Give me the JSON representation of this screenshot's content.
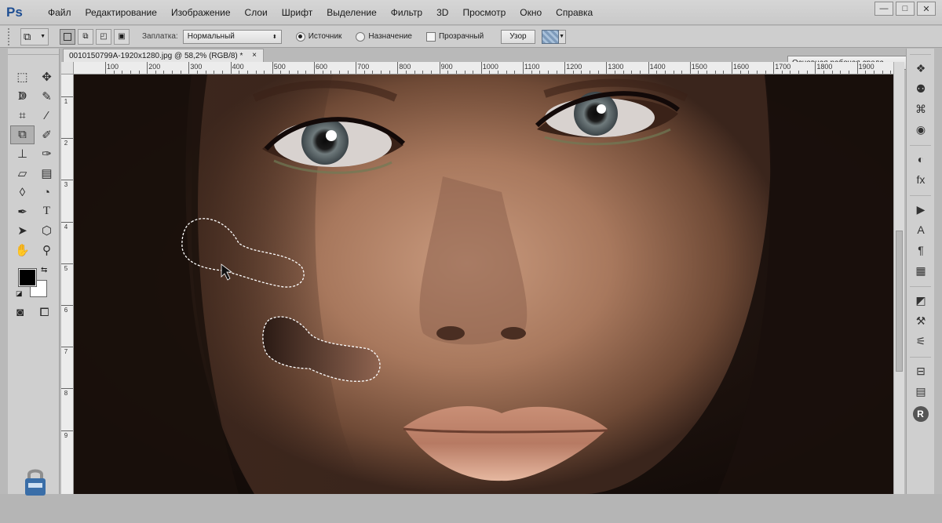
{
  "app": {
    "logo": "Ps"
  },
  "menu": [
    "Файл",
    "Редактирование",
    "Изображение",
    "Слои",
    "Шрифт",
    "Выделение",
    "Фильтр",
    "3D",
    "Просмотр",
    "Окно",
    "Справка"
  ],
  "window_controls": {
    "minimize": "—",
    "maximize": "□",
    "close": "✕"
  },
  "options": {
    "fill_label": "Заплатка:",
    "fill_mode": "Нормальный",
    "source_label": "Источник",
    "destination_label": "Назначение",
    "transparent_label": "Прозрачный",
    "pattern_label": "Узор",
    "workspace": "Основная рабочая среда",
    "selected_patch": "source"
  },
  "document": {
    "tab_title": "0010150799A-1920x1280.jpg @ 58,2% (RGB/8) *",
    "close": "×"
  },
  "ruler": {
    "h_labels": [
      "100",
      "200",
      "300",
      "400",
      "500",
      "600",
      "700",
      "800",
      "900",
      "1000",
      "1100",
      "1200",
      "1300",
      "1400",
      "1500",
      "1600",
      "1700",
      "1800",
      "1900"
    ],
    "v_labels": [
      "1",
      "2",
      "3",
      "4",
      "5",
      "6",
      "7",
      "8",
      "9"
    ]
  },
  "tools": [
    {
      "name": "marquee-tool-icon",
      "glyph": "⬚"
    },
    {
      "name": "move-tool-icon",
      "glyph": "✥"
    },
    {
      "name": "lasso-tool-icon",
      "glyph": "ↇ"
    },
    {
      "name": "quick-select-icon",
      "glyph": "✎"
    },
    {
      "name": "crop-tool-icon",
      "glyph": "⌗"
    },
    {
      "name": "eyedropper-icon",
      "glyph": "⁄"
    },
    {
      "name": "patch-tool-icon",
      "glyph": "⧉"
    },
    {
      "name": "brush-tool-icon",
      "glyph": "✐"
    },
    {
      "name": "stamp-tool-icon",
      "glyph": "⊥"
    },
    {
      "name": "history-brush-icon",
      "glyph": "✑"
    },
    {
      "name": "eraser-tool-icon",
      "glyph": "▱"
    },
    {
      "name": "gradient-tool-icon",
      "glyph": "▤"
    },
    {
      "name": "blur-tool-icon",
      "glyph": "◊"
    },
    {
      "name": "dodge-tool-icon",
      "glyph": "◔"
    },
    {
      "name": "pen-tool-icon",
      "glyph": "✒"
    },
    {
      "name": "type-tool-icon",
      "glyph": "T"
    },
    {
      "name": "path-select-icon",
      "glyph": "➤"
    },
    {
      "name": "shape-tool-icon",
      "glyph": "⬡"
    },
    {
      "name": "hand-tool-icon",
      "glyph": "✋"
    },
    {
      "name": "zoom-tool-icon",
      "glyph": "⚲"
    }
  ],
  "right_panel_icons": [
    {
      "name": "layers-icon",
      "glyph": "❖"
    },
    {
      "name": "channels-icon",
      "glyph": "⚉"
    },
    {
      "name": "paths-icon",
      "glyph": "⌘"
    },
    {
      "name": "3d-icon",
      "glyph": "◉"
    },
    {
      "name": "adjustments-icon",
      "glyph": "◐"
    },
    {
      "name": "styles-icon",
      "glyph": "fx"
    },
    {
      "name": "actions-icon",
      "glyph": "▶"
    },
    {
      "name": "character-icon",
      "glyph": "A"
    },
    {
      "name": "paragraph-icon",
      "glyph": "¶"
    },
    {
      "name": "swatches-icon",
      "glyph": "▦"
    },
    {
      "name": "navigator-icon",
      "glyph": "◩"
    },
    {
      "name": "clone-source-icon",
      "glyph": "⚒"
    },
    {
      "name": "brush-presets-icon",
      "glyph": "⚟"
    },
    {
      "name": "tool-presets-icon",
      "glyph": "⊟"
    },
    {
      "name": "notes-icon",
      "glyph": "▤"
    },
    {
      "name": "info-icon",
      "glyph": "R"
    }
  ],
  "colors": {
    "foreground": "#000000",
    "background": "#ffffff",
    "accent": "#1f4f93"
  }
}
